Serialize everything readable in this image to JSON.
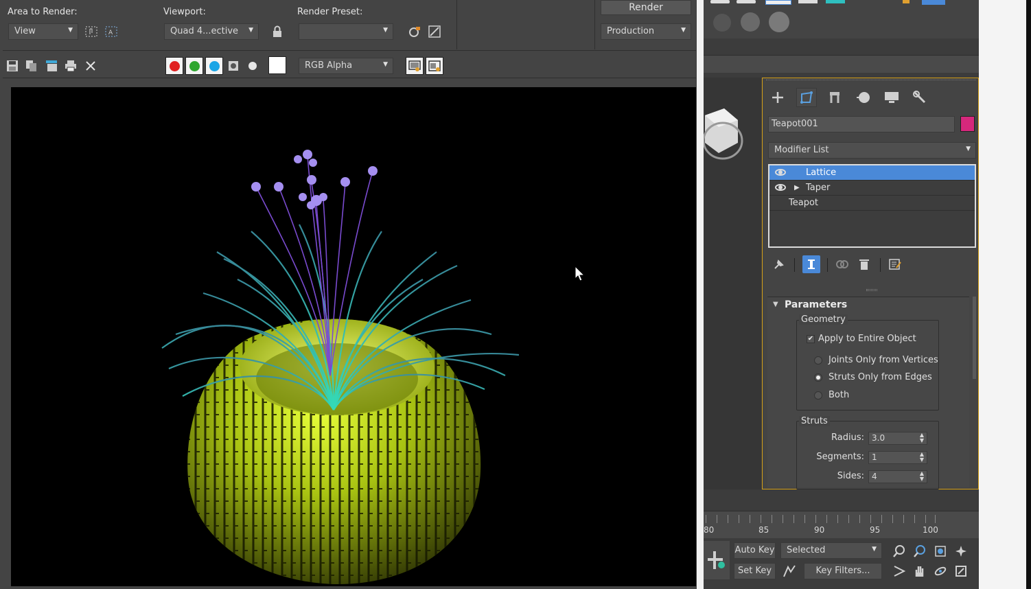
{
  "render_window": {
    "area_label": "Area to Render:",
    "area_value": "View",
    "viewport_label": "Viewport:",
    "viewport_value": "Quad 4...ective",
    "preset_label": "Render Preset:",
    "preset_value": "",
    "render_button": "Render",
    "production_value": "Production",
    "channel_value": "RGB Alpha",
    "channels": [
      {
        "name": "red-channel",
        "color": "#e02020"
      },
      {
        "name": "green-channel",
        "color": "#2fa62f"
      },
      {
        "name": "blue-channel",
        "color": "#1aa5e6"
      }
    ]
  },
  "command_panel": {
    "object_name": "Teapot001",
    "object_color": "#d6287c",
    "modifier_list_label": "Modifier List",
    "stack": [
      {
        "label": "Lattice",
        "selected": true,
        "eye": true,
        "expander": false
      },
      {
        "label": "Taper",
        "selected": false,
        "eye": true,
        "expander": true
      },
      {
        "label": "Teapot",
        "selected": false,
        "eye": false,
        "expander": false
      }
    ],
    "rollout_title": "Parameters",
    "geometry_group": "Geometry",
    "apply_entire": "Apply to Entire Object",
    "apply_entire_checked": true,
    "radio_options": [
      {
        "label": "Joints Only from Vertices",
        "checked": false
      },
      {
        "label": "Struts Only from Edges",
        "checked": true
      },
      {
        "label": "Both",
        "checked": false
      }
    ],
    "struts_group": "Struts",
    "struts_params": [
      {
        "label": "Radius:",
        "value": "3.0"
      },
      {
        "label": "Segments:",
        "value": "1"
      },
      {
        "label": "Sides:",
        "value": "4"
      }
    ]
  },
  "timeline": {
    "ticks": [
      "80",
      "85",
      "90",
      "95",
      "100"
    ]
  },
  "bottom_controls": {
    "auto_key": "Auto Key",
    "set_key": "Set Key",
    "selected_value": "Selected",
    "key_filters": "Key Filters..."
  },
  "colors": {
    "panel_bg": "#444444",
    "highlight": "#4a89d8",
    "border_accent": "#d4a017"
  }
}
